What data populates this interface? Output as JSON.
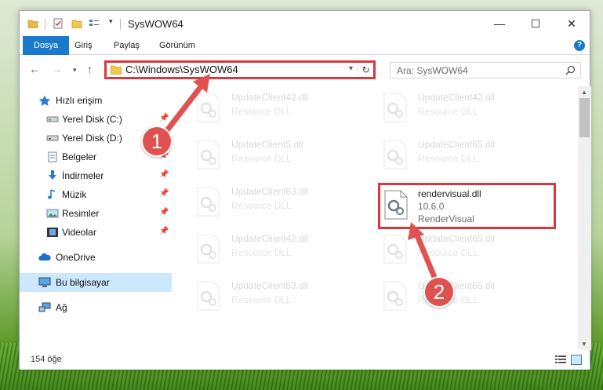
{
  "window": {
    "title": "SysWOW64",
    "controls": {
      "minimize": "—",
      "maximize": "☐",
      "close": "✕"
    }
  },
  "quick_access": {
    "dropdown": "▾"
  },
  "ribbon": {
    "tabs": [
      "Dosya",
      "Giriş",
      "Paylaş",
      "Görünüm"
    ],
    "help": "?"
  },
  "nav": {
    "back": "←",
    "forward": "→",
    "recent": "▾",
    "up": "↑",
    "address": "C:\\Windows\\SysWOW64",
    "address_chevron": "▾",
    "refresh": "↻",
    "search_placeholder": "Ara: SysWOW64"
  },
  "sidebar": {
    "pin": "📌",
    "items": [
      {
        "label": "Hızlı erişim",
        "icon": "star-icon"
      },
      {
        "label": "Yerel Disk (C:)",
        "icon": "drive-icon"
      },
      {
        "label": "Yerel Disk (D:)",
        "icon": "drive-icon"
      },
      {
        "label": "Belgeler",
        "icon": "documents-icon"
      },
      {
        "label": "İndirmeler",
        "icon": "download-icon"
      },
      {
        "label": "Müzik",
        "icon": "music-icon"
      },
      {
        "label": "Resimler",
        "icon": "pictures-icon"
      },
      {
        "label": "Videolar",
        "icon": "video-icon"
      },
      {
        "label": "OneDrive",
        "icon": "cloud-icon"
      },
      {
        "label": "Bu bilgisayar",
        "icon": "computer-icon"
      },
      {
        "label": "Ağ",
        "icon": "network-icon"
      }
    ]
  },
  "files": [
    {
      "name": "UpdateClient42.dll",
      "desc": "Resource DLL"
    },
    {
      "name": "UpdateClient42.dll",
      "desc": "Resource DLL"
    },
    {
      "name": "UpdateClient5.dll",
      "desc": "Resource DLL"
    },
    {
      "name": "UpdateClient65.dll",
      "desc": "Resource DLL"
    },
    {
      "name": "UpdateClient63.dll",
      "desc": "Resource DLL"
    },
    {
      "name": "UpdateClient42.dll",
      "desc": "Resource DLL"
    },
    {
      "name": "UpdateClient65.dll",
      "desc": "Resource DLL"
    },
    {
      "name": "UpdateClient63.dll",
      "desc": "Resource DLL"
    },
    {
      "name": "UpdateClient65.dll",
      "desc": "Resource DLL"
    }
  ],
  "highlighted_file": {
    "name": "rendervisual.dll",
    "version": "10.6.0",
    "desc": "RenderVisual"
  },
  "scrollbar": {
    "up": "▲",
    "down": "▼"
  },
  "status": {
    "count": "154 öğe"
  },
  "annotations": {
    "marker1": "1",
    "marker2": "2"
  },
  "colors": {
    "accent": "#1979ca",
    "highlight_red": "#d9373b",
    "marker_red": "#e05252",
    "selected": "#cce8ff"
  }
}
